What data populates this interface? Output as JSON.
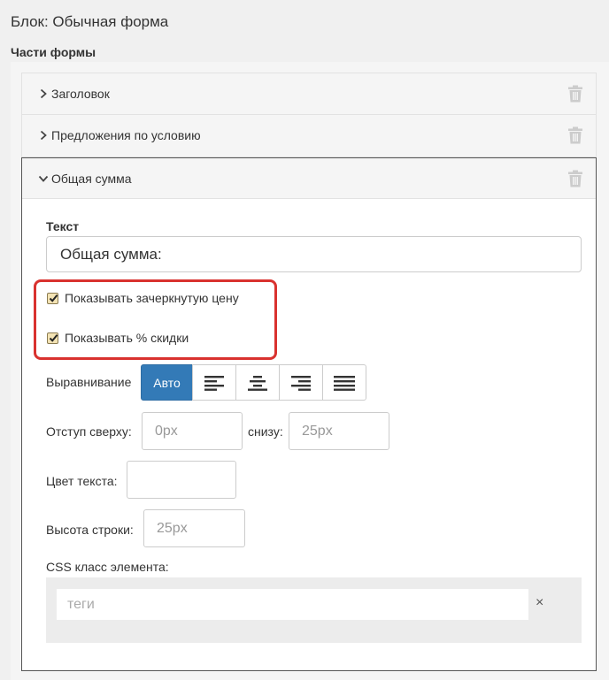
{
  "block_title": "Блок: Обычная форма",
  "section_label": "Части формы",
  "parts": [
    {
      "label": "Заголовок",
      "expanded": false
    },
    {
      "label": "Предложения по условию",
      "expanded": false
    },
    {
      "label": "Общая сумма",
      "expanded": true
    }
  ],
  "editor": {
    "text_label": "Текст",
    "text_value": "Общая сумма:",
    "show_strikethrough_label": "Показывать зачеркнутую цену",
    "show_strikethrough_checked": true,
    "show_discount_label": "Показывать % скидки",
    "show_discount_checked": true,
    "align_label": "Выравнивание",
    "align_auto_label": "Авто",
    "align_options": [
      "align-left-icon",
      "align-center-icon",
      "align-right-icon",
      "align-justify-icon"
    ],
    "margin_top_label": "Отступ сверху:",
    "margin_top_placeholder": "0px",
    "margin_bottom_label": "снизу:",
    "margin_bottom_placeholder": "25px",
    "text_color_label": "Цвет текста:",
    "line_height_label": "Высота строки:",
    "line_height_placeholder": "25px",
    "css_class_label": "CSS класс элемента:",
    "tags_placeholder": "теги",
    "tags_clear": "×"
  },
  "colors": {
    "accent": "#337ab7",
    "highlight": "#d9322f"
  }
}
